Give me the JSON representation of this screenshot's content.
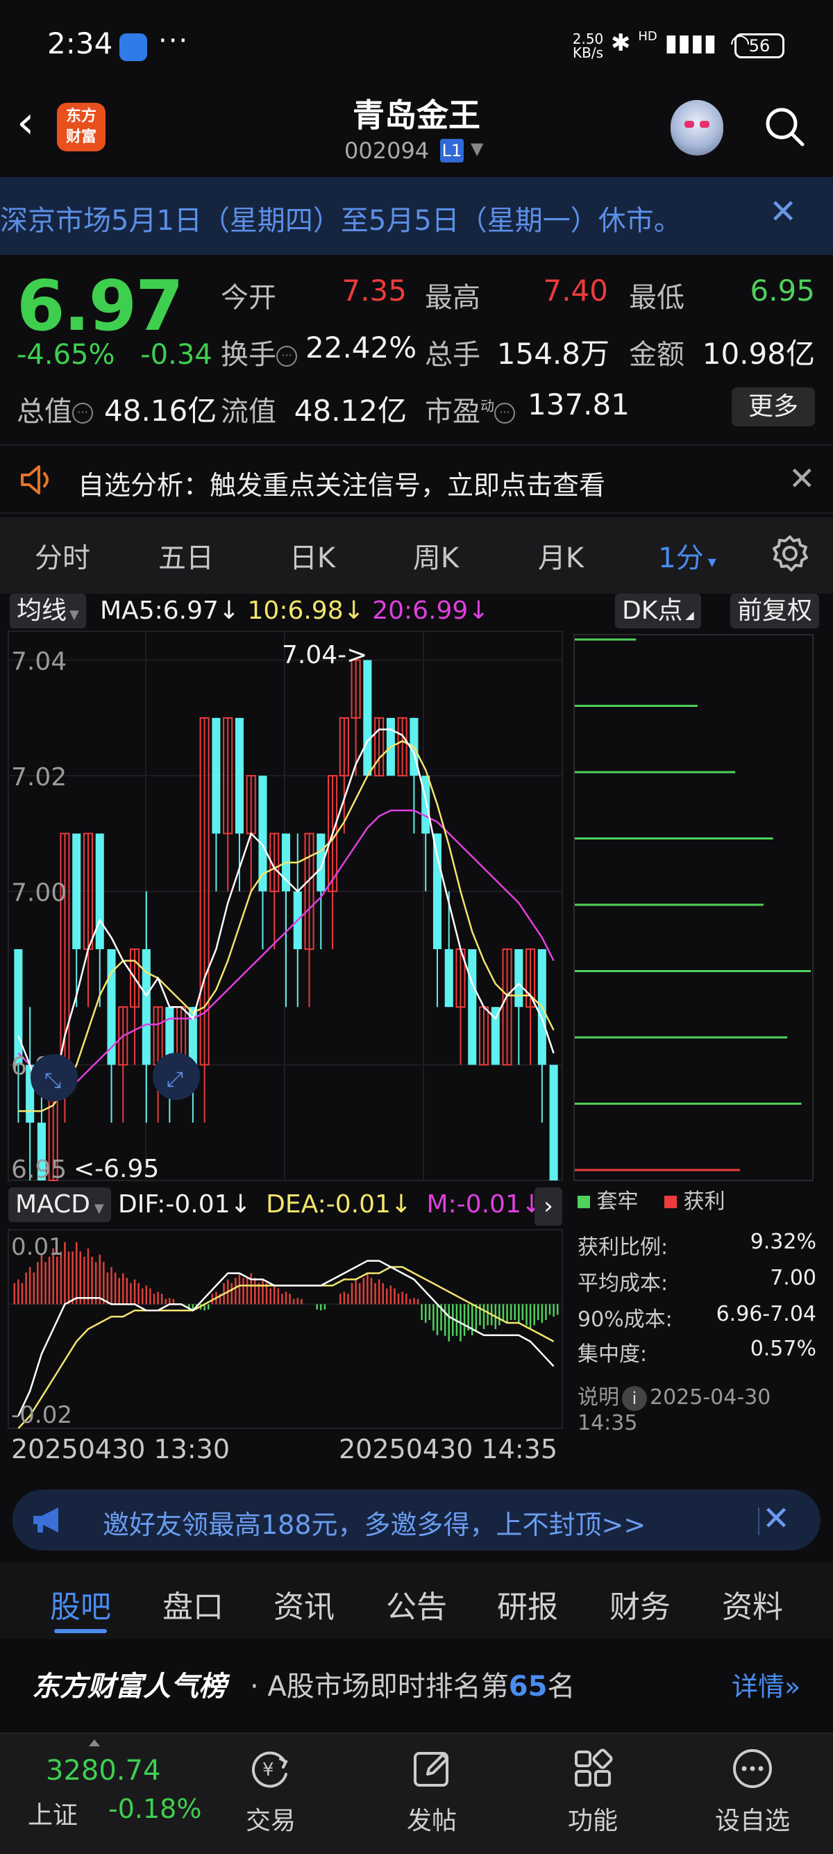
{
  "status_bar": {
    "time": "2:34",
    "more": "···",
    "net_speed_value": "2.50",
    "net_speed_unit": "KB/s",
    "hd_label": "HD",
    "battery": "56"
  },
  "header": {
    "logo_text_1": "东方",
    "logo_text_2": "财富",
    "title": "青岛金王",
    "code": "002094",
    "level_badge": "L1"
  },
  "banner": {
    "text": "深京市场5月1日（星期四）至5月5日（星期一）休市。"
  },
  "quote": {
    "price": "6.97",
    "change_pct": "-4.65%",
    "change_abs": "-0.34",
    "fields": [
      {
        "label": "今开",
        "value": "7.35",
        "color": "#ee3b3b"
      },
      {
        "label": "最高",
        "value": "7.40",
        "color": "#ee3b3b"
      },
      {
        "label": "最低",
        "value": "6.95",
        "color": "#4fd15a"
      },
      {
        "label": "换手",
        "value": "22.42%",
        "color": "#f2f2f2"
      },
      {
        "label": "总手",
        "value": "154.8万",
        "color": "#f2f2f2"
      },
      {
        "label": "金额",
        "value": "10.98亿",
        "color": "#f2f2f2"
      },
      {
        "label": "总值",
        "value": "48.16亿",
        "color": "#f2f2f2"
      },
      {
        "label": "流值",
        "value": "48.12亿",
        "color": "#f2f2f2"
      },
      {
        "label": "市盈",
        "value": "137.81",
        "color": "#f2f2f2"
      }
    ],
    "pe_superscript": "动",
    "more_button": "更多"
  },
  "analysis": {
    "text": "自选分析：触发重点关注信号，立即点击查看"
  },
  "period_tabs": {
    "items": [
      "分时",
      "五日",
      "日K",
      "周K",
      "月K",
      "1分"
    ],
    "active": "1分",
    "dropdown_caret": "▾"
  },
  "ma_bar": {
    "selector": "均线",
    "ma5": "MA5:6.97",
    "ma10": "10:6.98",
    "ma20": "20:6.99",
    "arrow": "↓",
    "dk_label": "DK点",
    "adjust_label": "前复权"
  },
  "chart_data": [
    {
      "type": "candlestick",
      "yaxis_ticks": [
        "7.04",
        "7.02",
        "7.00",
        "6.97",
        "6.95"
      ],
      "high_marker": "7.04->",
      "low_marker": "<-6.95",
      "x_labels": [
        "20250430 13:30",
        "20250430 14:35"
      ],
      "series": [
        {
          "name": "MA5",
          "color": "#ffffff"
        },
        {
          "name": "MA10",
          "color": "#f3e66b"
        },
        {
          "name": "MA20",
          "color": "#e040e0"
        }
      ],
      "candles": [
        [
          6.99,
          6.97,
          6.99,
          6.96
        ],
        [
          6.97,
          6.96,
          6.98,
          6.95
        ],
        [
          6.96,
          6.95,
          6.97,
          6.95
        ],
        [
          6.95,
          6.97,
          6.97,
          6.95
        ],
        [
          6.97,
          7.01,
          7.01,
          6.96
        ],
        [
          7.01,
          6.99,
          7.01,
          6.98
        ],
        [
          6.99,
          7.01,
          7.01,
          6.98
        ],
        [
          7.01,
          6.99,
          7.01,
          6.98
        ],
        [
          6.99,
          6.97,
          6.99,
          6.96
        ],
        [
          6.97,
          6.98,
          6.98,
          6.96
        ],
        [
          6.98,
          6.99,
          6.99,
          6.97
        ],
        [
          6.99,
          6.97,
          7.0,
          6.96
        ],
        [
          6.97,
          6.98,
          6.98,
          6.96
        ],
        [
          6.98,
          6.97,
          6.98,
          6.96
        ],
        [
          6.97,
          6.98,
          6.98,
          6.97
        ],
        [
          6.98,
          6.97,
          6.98,
          6.96
        ],
        [
          6.97,
          7.03,
          7.03,
          6.96
        ],
        [
          7.03,
          7.01,
          7.03,
          7.0
        ],
        [
          7.01,
          7.03,
          7.03,
          7.0
        ],
        [
          7.03,
          7.01,
          7.03,
          7.0
        ],
        [
          7.01,
          7.02,
          7.02,
          7.0
        ],
        [
          7.02,
          7.0,
          7.02,
          6.99
        ],
        [
          7.0,
          7.01,
          7.01,
          6.99
        ],
        [
          7.01,
          7.0,
          7.01,
          6.98
        ],
        [
          7.0,
          6.99,
          7.01,
          6.98
        ],
        [
          6.99,
          7.01,
          7.01,
          6.98
        ],
        [
          7.01,
          7.0,
          7.01,
          6.99
        ],
        [
          7.0,
          7.02,
          7.02,
          6.99
        ],
        [
          7.02,
          7.03,
          7.03,
          7.01
        ],
        [
          7.03,
          7.04,
          7.04,
          7.02
        ],
        [
          7.04,
          7.02,
          7.04,
          7.02
        ],
        [
          7.02,
          7.03,
          7.03,
          7.02
        ],
        [
          7.03,
          7.02,
          7.03,
          7.02
        ],
        [
          7.02,
          7.03,
          7.03,
          7.02
        ],
        [
          7.03,
          7.02,
          7.03,
          7.01
        ],
        [
          7.02,
          7.01,
          7.02,
          7.0
        ],
        [
          7.01,
          6.99,
          7.01,
          6.98
        ],
        [
          6.99,
          6.98,
          7.0,
          6.98
        ],
        [
          6.98,
          6.99,
          6.99,
          6.97
        ],
        [
          6.99,
          6.97,
          6.99,
          6.97
        ],
        [
          6.97,
          6.98,
          6.98,
          6.97
        ],
        [
          6.98,
          6.97,
          6.98,
          6.97
        ],
        [
          6.97,
          6.99,
          6.99,
          6.97
        ],
        [
          6.99,
          6.98,
          6.99,
          6.97
        ],
        [
          6.98,
          6.99,
          6.99,
          6.97
        ],
        [
          6.99,
          6.97,
          6.99,
          6.96
        ],
        [
          6.97,
          6.95,
          6.97,
          6.95
        ]
      ],
      "ma5": [
        6.975,
        6.97,
        6.965,
        6.965,
        6.975,
        6.982,
        6.99,
        6.995,
        6.992,
        6.988,
        6.985,
        6.982,
        6.985,
        6.98,
        6.98,
        6.978,
        6.985,
        6.99,
        6.998,
        7.004,
        7.01,
        7.008,
        7.004,
        7.002,
        7.0,
        7.002,
        7.004,
        7.01,
        7.016,
        7.022,
        7.026,
        7.028,
        7.028,
        7.027,
        7.024,
        7.016,
        7.006,
        6.998,
        6.99,
        6.984,
        6.98,
        6.978,
        6.982,
        6.984,
        6.982,
        6.978,
        6.972
      ],
      "ma10": [
        6.962,
        6.962,
        6.962,
        6.963,
        6.966,
        6.97,
        6.976,
        6.982,
        6.986,
        6.988,
        6.988,
        6.986,
        6.985,
        6.983,
        6.981,
        6.979,
        6.98,
        6.983,
        6.988,
        6.994,
        7.0,
        7.003,
        7.004,
        7.005,
        7.005,
        7.006,
        7.007,
        7.009,
        7.012,
        7.016,
        7.02,
        7.023,
        7.025,
        7.026,
        7.025,
        7.021,
        7.015,
        7.008,
        7.0,
        6.993,
        6.988,
        6.984,
        6.982,
        6.982,
        6.982,
        6.98,
        6.976
      ],
      "ma20": [
        6.972,
        6.97,
        6.967,
        6.966,
        6.966,
        6.967,
        6.969,
        6.971,
        6.973,
        6.975,
        6.976,
        6.977,
        6.977,
        6.978,
        6.978,
        6.978,
        6.979,
        6.981,
        6.983,
        6.985,
        6.987,
        6.989,
        6.991,
        6.993,
        6.995,
        6.997,
        6.999,
        7.002,
        7.005,
        7.008,
        7.011,
        7.013,
        7.014,
        7.014,
        7.014,
        7.013,
        7.012,
        7.01,
        7.008,
        7.006,
        7.004,
        7.002,
        7.0,
        6.998,
        6.995,
        6.992,
        6.988
      ]
    },
    {
      "type": "bar",
      "name": "MACD",
      "indicator": "MACD",
      "dif": "DIF:-0.01",
      "dea": "DEA:-0.01",
      "m": "M:-0.01",
      "arrow": "↓",
      "yaxis_ticks": [
        "0.01",
        "-0.02"
      ],
      "histogram": [
        0.004,
        0.006,
        0.008,
        0.009,
        0.01,
        0.01,
        0.009,
        0.008,
        0.006,
        0.005,
        0.004,
        0.003,
        0.002,
        0.001,
        0.0,
        -0.001,
        -0.001,
        0.002,
        0.004,
        0.005,
        0.005,
        0.004,
        0.003,
        0.002,
        0.001,
        0.0,
        -0.001,
        0.0,
        0.002,
        0.004,
        0.005,
        0.004,
        0.003,
        0.002,
        0.001,
        -0.003,
        -0.005,
        -0.006,
        -0.006,
        -0.005,
        -0.004,
        -0.004,
        -0.003,
        -0.003,
        -0.004,
        -0.003,
        -0.002
      ],
      "dif_series": [
        -0.018,
        -0.014,
        -0.008,
        -0.004,
        0.0,
        0.001,
        0.001,
        0.001,
        0.0,
        0.0,
        0.0,
        -0.001,
        -0.001,
        0.0,
        0.0,
        -0.001,
        0.001,
        0.003,
        0.005,
        0.005,
        0.004,
        0.004,
        0.003,
        0.003,
        0.003,
        0.003,
        0.003,
        0.004,
        0.005,
        0.006,
        0.007,
        0.007,
        0.006,
        0.005,
        0.004,
        0.002,
        0.0,
        -0.002,
        -0.003,
        -0.004,
        -0.005,
        -0.005,
        -0.005,
        -0.005,
        -0.006,
        -0.008,
        -0.01
      ],
      "dea_series": [
        -0.02,
        -0.018,
        -0.015,
        -0.012,
        -0.009,
        -0.006,
        -0.004,
        -0.003,
        -0.002,
        -0.002,
        -0.001,
        -0.001,
        -0.001,
        -0.001,
        -0.001,
        -0.001,
        0.0,
        0.001,
        0.002,
        0.003,
        0.003,
        0.003,
        0.003,
        0.003,
        0.003,
        0.003,
        0.003,
        0.003,
        0.004,
        0.004,
        0.005,
        0.005,
        0.006,
        0.006,
        0.005,
        0.004,
        0.003,
        0.002,
        0.001,
        0.0,
        -0.001,
        -0.002,
        -0.003,
        -0.003,
        -0.004,
        -0.005,
        -0.006
      ]
    }
  ],
  "volume_profile": {
    "levels": [
      {
        "value": 0.26,
        "color": "#4fd15a"
      },
      {
        "value": 0.52,
        "color": "#4fd15a"
      },
      {
        "value": 0.68,
        "color": "#4fd15a"
      },
      {
        "value": 0.84,
        "color": "#4fd15a"
      },
      {
        "value": 0.8,
        "color": "#4fd15a"
      },
      {
        "value": 1.0,
        "color": "#4fd15a"
      },
      {
        "value": 0.9,
        "color": "#4fd15a"
      },
      {
        "value": 0.96,
        "color": "#4fd15a"
      },
      {
        "value": 0.7,
        "color": "#ee3b3b"
      }
    ],
    "legend_trapped": "套牢",
    "legend_profit": "获利"
  },
  "cost": {
    "rows": [
      {
        "label": "获利比例:",
        "value": "9.32%"
      },
      {
        "label": "平均成本:",
        "value": "7.00"
      },
      {
        "label": "90%成本:",
        "value": "6.96-7.04"
      },
      {
        "label": "集中度:",
        "value": "0.57%"
      }
    ],
    "note_label": "说明",
    "note_time": "2025-04-30 14:35"
  },
  "invite": {
    "text": "邀好友领最高188元，多邀多得，上不封顶>>"
  },
  "info_tabs": {
    "items": [
      "股吧",
      "盘口",
      "资讯",
      "公告",
      "研报",
      "财务",
      "资料"
    ],
    "active": "股吧"
  },
  "rank": {
    "brand": "东方财富人气榜",
    "prefix": "· A股市场即时排名第",
    "number": "65",
    "suffix": "名",
    "detail": "详情»"
  },
  "bottom_nav": {
    "index_value": "3280.74",
    "index_name": "上证",
    "index_change": "-0.18%",
    "items": [
      "交易",
      "发帖",
      "功能",
      "设自选"
    ]
  },
  "colors": {
    "up": "#ee3b3b",
    "down": "#5ff0f0",
    "accent": "#4a8cf0",
    "bg": "#0d0d0f"
  }
}
